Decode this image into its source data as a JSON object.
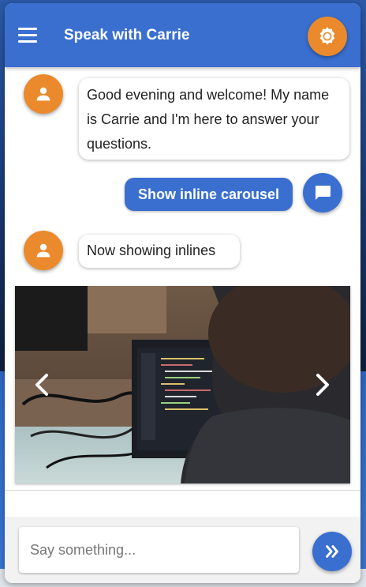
{
  "header": {
    "title": "Speak with Carrie",
    "menu_icon": "menu-icon",
    "theme_icon": "brightness-icon"
  },
  "messages": [
    {
      "from": "bot",
      "text": "Good evening and welcome! My name is Carrie and I'm here to answer your questions.",
      "avatar_icon": "person-icon"
    },
    {
      "from": "user",
      "text": "Show inline carousel",
      "avatar_icon": "chat-icon"
    },
    {
      "from": "bot",
      "text": "Now showing inlines",
      "avatar_icon": "person-icon"
    }
  ],
  "carousel": {
    "prev_icon": "chevron-left-icon",
    "next_icon": "chevron-right-icon",
    "image_description": "programmer-at-laptop-photo"
  },
  "composer": {
    "placeholder": "Say something...",
    "send_icon": "double-chevron-right-icon"
  },
  "colors": {
    "primary": "#3a6fd0",
    "accent": "#ea8a2c",
    "bubble_bot_bg": "#ffffff",
    "bubble_user_bg": "#3a6fd0"
  }
}
